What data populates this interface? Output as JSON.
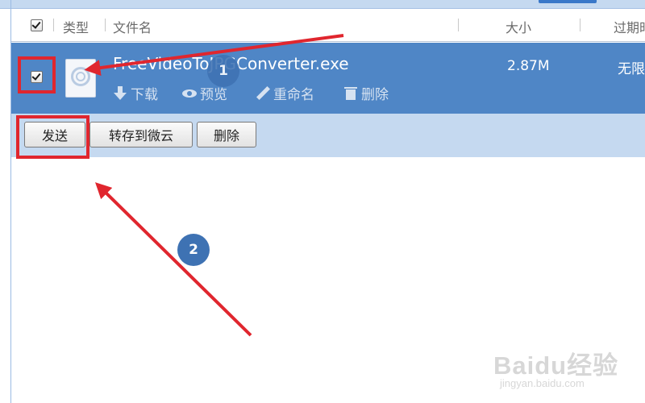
{
  "header": {
    "type_label": "类型",
    "name_label": "文件名",
    "size_label": "大小",
    "expire_label": "过期时"
  },
  "file": {
    "name": "FreeVideoToJPGConverter.exe",
    "size": "2.87M",
    "expire": "无限",
    "actions": {
      "download": "下载",
      "preview": "预览",
      "rename": "重命名",
      "delete": "删除"
    }
  },
  "toolbar": {
    "send": "发送",
    "save_to_weiyun": "转存到微云",
    "delete": "删除"
  },
  "annotations": {
    "step1": "1",
    "step2": "2"
  },
  "watermark": {
    "logo": "Baidu经验",
    "url": "jingyan.baidu.com"
  },
  "colors": {
    "selected_row": "#4f86c6",
    "toolbar_bg": "#c5d9f0",
    "highlight_red": "#e0262e",
    "badge_blue": "#3e72b3"
  }
}
